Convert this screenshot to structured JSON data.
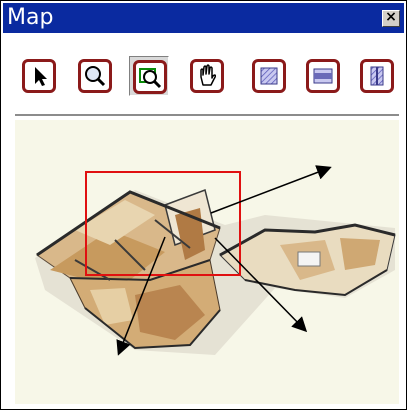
{
  "window": {
    "title": "Map",
    "close_symbol": "×"
  },
  "toolbar": {
    "buttons": [
      {
        "name": "select-tool",
        "icon": "arrow-pointer-icon",
        "active": false
      },
      {
        "name": "zoom-tool",
        "icon": "magnifier-icon",
        "active": false
      },
      {
        "name": "zoom-region-tool",
        "icon": "zoom-region-icon",
        "active": true
      },
      {
        "name": "pan-tool",
        "icon": "hand-icon",
        "active": false
      },
      {
        "name": "view-1-tool",
        "icon": "hatched-square-icon",
        "active": false
      },
      {
        "name": "view-2-tool",
        "icon": "banded-square-icon",
        "active": false
      },
      {
        "name": "view-3-tool",
        "icon": "hatched-door-icon",
        "active": false
      }
    ],
    "accent": "#8b1a1a"
  },
  "map": {
    "background": "#f7f7e8",
    "selection_color": "#e01010",
    "arrow_count": 3
  }
}
